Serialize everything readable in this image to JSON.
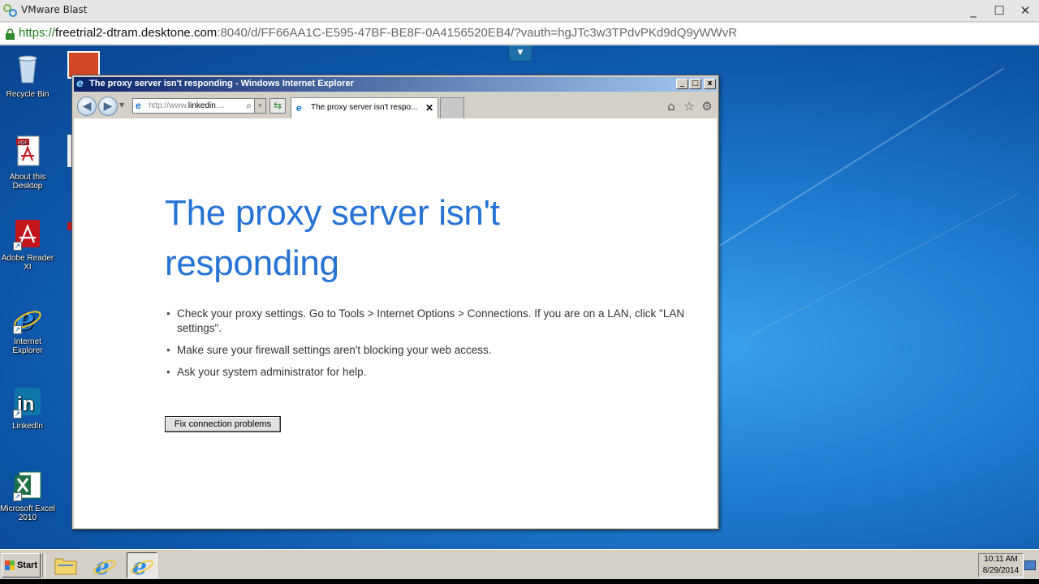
{
  "vm_window": {
    "title": "VMware Blast",
    "minimize": "_",
    "maximize": "☐",
    "close": "✕",
    "url_scheme": "https://",
    "url_host": "freetrial2-dtram.desktone.com",
    "url_path": ":8040/d/FF66AA1C-E595-47BF-BE8F-0A4156520EB4/?vauth=hgJTc3w3TPdvPKd9dQ9yWWvR"
  },
  "desktop": {
    "icons": [
      {
        "label": "Recycle Bin",
        "icon": "recycle-bin-icon"
      },
      {
        "label": "About this Desktop",
        "icon": "pdf-icon"
      },
      {
        "label": "Adobe Reader XI",
        "icon": "adobe-reader-icon"
      },
      {
        "label": "Internet Explorer",
        "icon": "internet-explorer-icon"
      },
      {
        "label": "LinkedIn",
        "icon": "linkedin-icon"
      },
      {
        "label": "Microsoft Excel 2010",
        "icon": "excel-icon"
      }
    ]
  },
  "ie": {
    "window_title": "The proxy server isn't responding - Windows Internet Explorer",
    "address_prefix": "http://www.",
    "address_domain": "linkedin",
    "address_suffix": "....",
    "tab_title": "The proxy server isn't respo...",
    "tab_close": "✕",
    "error_title": "The proxy server isn't responding",
    "bullets": [
      "Check your proxy settings. Go to Tools > Internet Options > Connections. If you are on a LAN, click \"LAN settings\".",
      "Make sure your firewall settings aren't blocking your web access.",
      "Ask your system administrator for help."
    ],
    "fix_button": "Fix connection problems"
  },
  "taskbar": {
    "start_label": "Start",
    "clock_time": "10:11 AM",
    "clock_date": "8/29/2014"
  },
  "colors": {
    "error_title": "#2673d6",
    "desktop_blue": "#1f7bd0",
    "titlebar": "#0a246a"
  }
}
